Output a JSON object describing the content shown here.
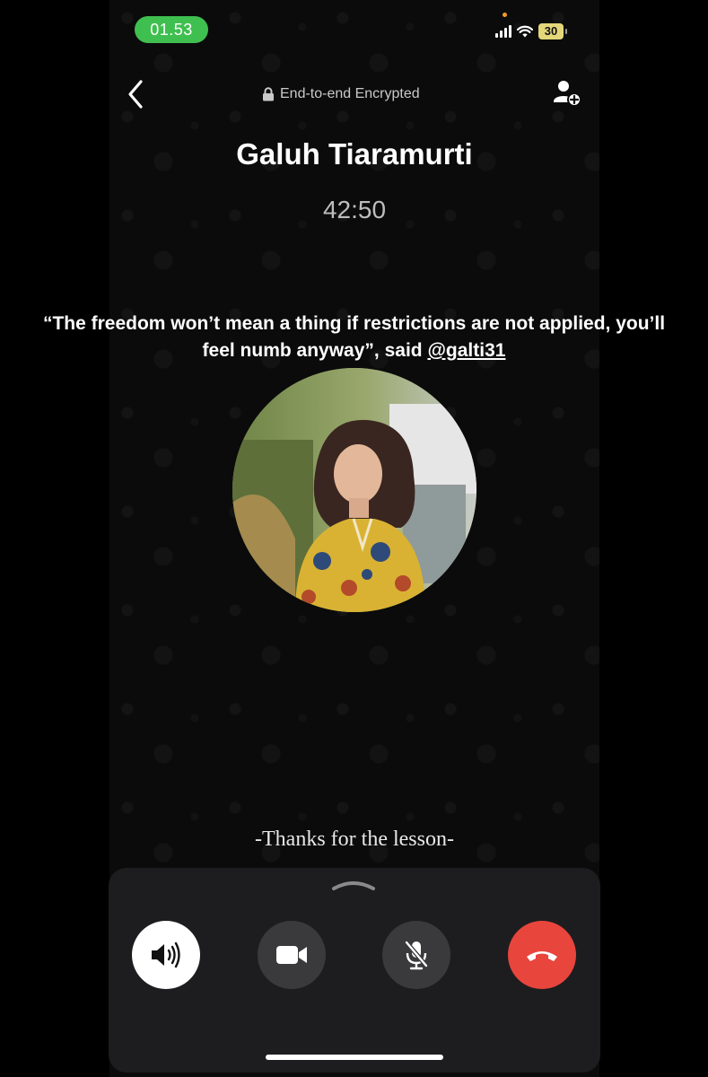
{
  "status_bar": {
    "time": "01.53",
    "battery": "30"
  },
  "header": {
    "encryption_label": "End-to-end Encrypted"
  },
  "call": {
    "caller_name": "Galuh Tiaramurti",
    "duration": "42:50"
  },
  "overlay": {
    "quote": "“The freedom won’t mean a thing if restrictions are not applied, you’ll feel numb anyway”, said ",
    "handle": "@galti31",
    "caption": "-Thanks for the lesson-"
  },
  "controls": {
    "icons": [
      "speaker-icon",
      "video-icon",
      "mute-mic-icon",
      "end-call-icon"
    ]
  },
  "colors": {
    "time_pill": "#3fbf4f",
    "battery": "#e3d77a",
    "end_call": "#e8453c",
    "control_dark": "#3a3a3c"
  }
}
